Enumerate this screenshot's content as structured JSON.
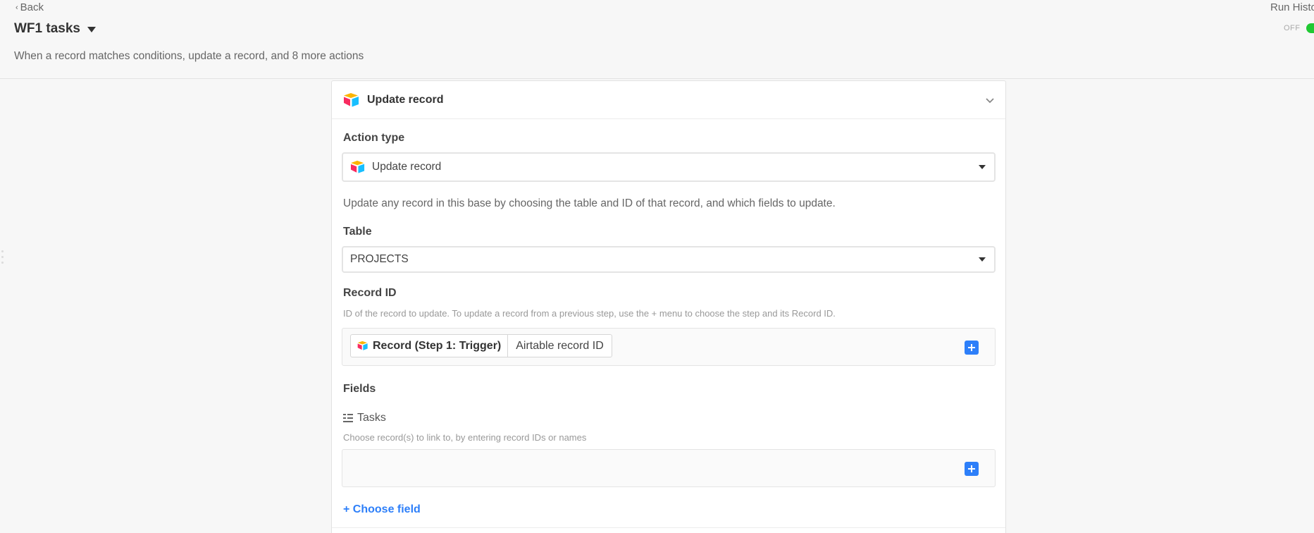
{
  "header": {
    "back_label": "Back",
    "workflow_title": "WF1 tasks",
    "description": "When a record matches conditions, update a record, and 8 more actions",
    "run_history_label": "Run History",
    "toggle_label": "OFF"
  },
  "card": {
    "title": "Update record",
    "action_type": {
      "label": "Action type",
      "value": "Update record",
      "help": "Update any record in this base by choosing the table and ID of that record, and which fields to update."
    },
    "table": {
      "label": "Table",
      "value": "PROJECTS"
    },
    "record_id": {
      "label": "Record ID",
      "help": "ID of the record to update. To update a record from a previous step, use the + menu to choose the step and its Record ID.",
      "token_step": "Record (Step 1: Trigger)",
      "token_field": "Airtable record ID"
    },
    "fields": {
      "label": "Fields",
      "field_name": "Tasks",
      "field_help": "Choose record(s) to link to, by entering record IDs or names",
      "field_icon": "linked-record-icon"
    },
    "choose_field_label": "+ Choose field"
  },
  "colors": {
    "accent_blue": "#2d7ff9",
    "toggle_green": "#20c933",
    "background": "#f7f7f7"
  }
}
